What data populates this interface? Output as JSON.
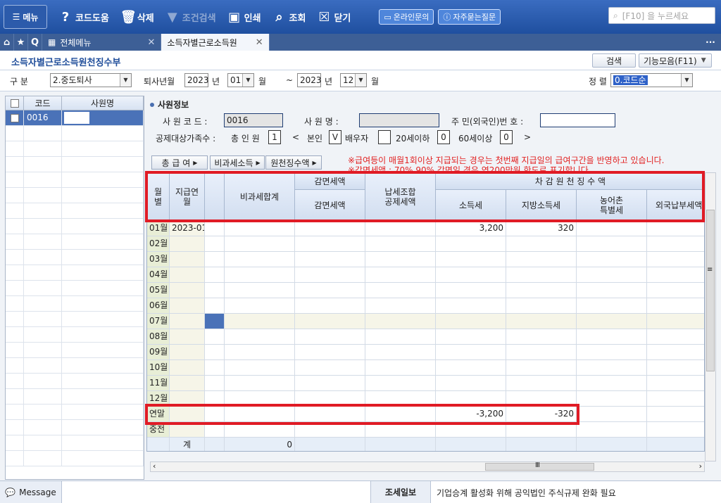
{
  "toolbar": {
    "menu": "메뉴",
    "code_help": "코드도움",
    "delete": "삭제",
    "cond_search": "조건검색",
    "print": "인쇄",
    "view": "조회",
    "close": "닫기",
    "online": "온라인문의",
    "faq": "자주묻는질문",
    "search_placeholder": "[F10] 을 누르세요"
  },
  "tabs": {
    "all_menu": "전체메뉴",
    "active": "소득자별근로소득원"
  },
  "window": {
    "title": "소득자별근로소득원천징수부",
    "search_btn": "검색",
    "func_btn": "기능모음(F11)"
  },
  "filter": {
    "gubun_label": "구    분",
    "gubun_value": "2.중도퇴사",
    "retire_label": "퇴사년월",
    "year_from": "2023",
    "year_unit": "년",
    "month_from": "01",
    "month_unit": "월",
    "tilde": "~",
    "year_to": "2023",
    "month_to": "12",
    "sort_label": "정 렬",
    "sort_value": "0.코드순"
  },
  "left_grid": {
    "col_code": "코드",
    "col_name": "사원명",
    "rows": [
      {
        "code": "0016",
        "name": ""
      }
    ]
  },
  "employee": {
    "section_title": "사원정보",
    "code_label": "사 원 코 드 :",
    "code_value": "0016",
    "name_label": "사 원 명 :",
    "name_value": "",
    "resident_label": "주 민(외국인)번 호 :",
    "resident_value": "",
    "family_label": "공제대상가족수 :",
    "total_label": "총 인 원",
    "total_value": "1",
    "lt": "<",
    "self_label": "본인",
    "self_value": "V",
    "spouse_label": "배우자",
    "spouse_value": "",
    "under20_label": "20세이하",
    "under20_value": "0",
    "over60_label": "60세이상",
    "over60_value": "0",
    "gt": ">"
  },
  "subtabs": {
    "pay": "총 급 여",
    "nontax": "비과세소득",
    "withhold": "원천징수액"
  },
  "notice": {
    "line1": "※급여등이 매월1회이상 지급되는 경우는 첫번째 지급일의 급여구간을 반영하고 있습니다.",
    "line2": "※감면세액 : 70% 90% 감면일 경우 연200만원 한도로 표기합니다."
  },
  "grid": {
    "h_month": "월\n별",
    "h_paymonth": "지급연\n월",
    "h_nontax": "비과세합계",
    "h_reduction_group": "감면세액",
    "h_reduction": "감면세액",
    "h_union": "납세조합\n공제세액",
    "h_withhold_group": "차 감 원 천 징 수 액",
    "h_income_tax": "소득세",
    "h_local_tax": "지방소득세",
    "h_rural_tax": "농어촌\n특별세",
    "h_foreign_tax": "외국납부세액",
    "rows": [
      {
        "month": "01월",
        "pay": "2023-01",
        "nontax": "",
        "income": "3,200",
        "local": "320"
      },
      {
        "month": "02월",
        "pay": "",
        "nontax": "",
        "income": "",
        "local": ""
      },
      {
        "month": "03월",
        "pay": "",
        "nontax": "",
        "income": "",
        "local": ""
      },
      {
        "month": "04월",
        "pay": "",
        "nontax": "",
        "income": "",
        "local": ""
      },
      {
        "month": "05월",
        "pay": "",
        "nontax": "",
        "income": "",
        "local": ""
      },
      {
        "month": "06월",
        "pay": "",
        "nontax": "",
        "income": "",
        "local": ""
      },
      {
        "month": "07월",
        "pay": "",
        "nontax": "",
        "income": "",
        "local": ""
      },
      {
        "month": "08월",
        "pay": "",
        "nontax": "",
        "income": "",
        "local": ""
      },
      {
        "month": "09월",
        "pay": "",
        "nontax": "",
        "income": "",
        "local": ""
      },
      {
        "month": "10월",
        "pay": "",
        "nontax": "",
        "income": "",
        "local": ""
      },
      {
        "month": "11월",
        "pay": "",
        "nontax": "",
        "income": "",
        "local": ""
      },
      {
        "month": "12월",
        "pay": "",
        "nontax": "",
        "income": "",
        "local": ""
      },
      {
        "month": "연말",
        "pay": "",
        "nontax": "",
        "income": "-3,200",
        "local": "-320"
      },
      {
        "month": "중전",
        "pay": "",
        "nontax": "",
        "income": "",
        "local": ""
      },
      {
        "month": "",
        "pay": "계",
        "nontax": "0",
        "income": "",
        "local": ""
      }
    ]
  },
  "status": {
    "message": "Message",
    "tax_title": "조세일보",
    "tax_text": "기업승계 활성화 위해 공익법인 주식규제 완화 필요"
  }
}
